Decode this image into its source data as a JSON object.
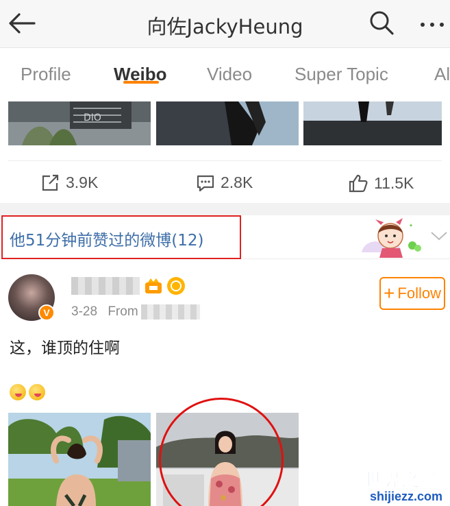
{
  "header": {
    "title": "向佐JackyHeung",
    "back_icon": "arrow-left-icon",
    "search_icon": "search-icon",
    "more_icon": "more-dots-icon"
  },
  "tabs": [
    {
      "label": "Profile",
      "active": false
    },
    {
      "label": "Weibo",
      "active": true
    },
    {
      "label": "Video",
      "active": false
    },
    {
      "label": "Super Topic",
      "active": false
    },
    {
      "label": "Al",
      "active": false
    }
  ],
  "accent_color": "#ff8200",
  "post_actions": {
    "repost": "3.9K",
    "comment": "2.8K",
    "like": "11.5K"
  },
  "liked_banner": {
    "text": "他51分钟前赞过的微博(12)",
    "text_color": "#3d6ea8",
    "highlight_color": "#e02020"
  },
  "post": {
    "date": "3-28",
    "from_label": "From",
    "follow_label": "Follow",
    "text": "这，谁顶的住啊",
    "emoji_count": 2,
    "verify_badge": "V"
  },
  "watermark": {
    "main": "世界之最",
    "sub": "shijiezz.com"
  }
}
